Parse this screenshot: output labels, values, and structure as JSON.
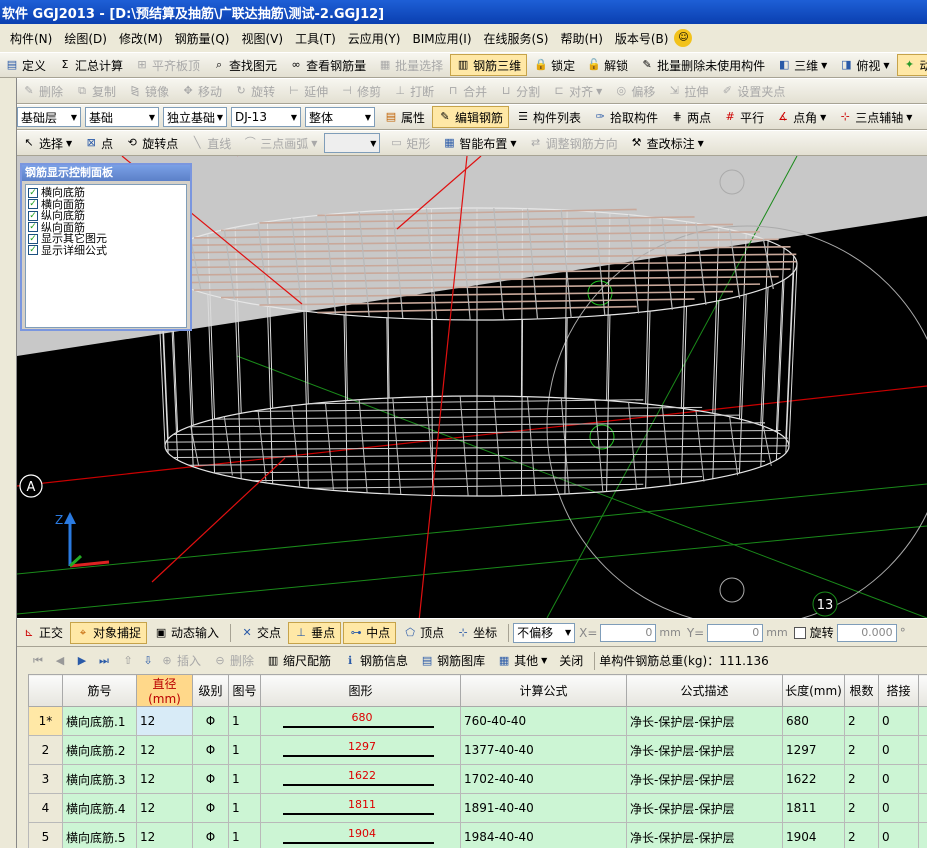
{
  "title": "软件 GGJ2013 - [D:\\预结算及抽筋\\广联达抽筋\\测试-2.GGJ12]",
  "menu": [
    "构件(N)",
    "绘图(D)",
    "修改(M)",
    "钢筋量(Q)",
    "视图(V)",
    "工具(T)",
    "云应用(Y)",
    "BIM应用(I)",
    "在线服务(S)",
    "帮助(H)",
    "版本号(B)"
  ],
  "toolbar1": {
    "define": "定义",
    "sum": "汇总计算",
    "flat": "平齐板顶",
    "find": "查找图元",
    "view_rebar": "查看钢筋量",
    "batch_select": "批量选择",
    "rebar3d": "钢筋三维",
    "lock": "锁定",
    "unlock": "解锁",
    "batch_delete": "批量删除未使用构件",
    "view3d": "三维",
    "topview": "俯视",
    "dynamic": "动"
  },
  "toolbar2": {
    "delete": "删除",
    "copy": "复制",
    "mirror": "镜像",
    "move": "移动",
    "rotate": "旋转",
    "extend": "延伸",
    "trim": "修剪",
    "break": "打断",
    "merge": "合并",
    "split": "分割",
    "align": "对齐",
    "offset": "偏移",
    "stretch": "拉伸",
    "setpoint": "设置夹点"
  },
  "toolbar3": {
    "layer": "基础层",
    "category": "基础",
    "type": "独立基础",
    "component": "DJ-13",
    "whole": "整体",
    "props": "属性",
    "edit_rebar": "编辑钢筋",
    "comp_list": "构件列表",
    "pick": "拾取构件",
    "two_points": "两点",
    "parallel": "平行",
    "point_angle": "点角",
    "three_aux": "三点辅轴"
  },
  "toolbar4": {
    "select": "选择",
    "point": "点",
    "rot_point": "旋转点",
    "line": "直线",
    "arc": "三点画弧",
    "rect": "矩形",
    "smart": "智能布置",
    "adjust": "调整钢筋方向",
    "edit_mark": "查改标注"
  },
  "panel": {
    "title": "钢筋显示控制面板",
    "items": [
      "横向底筋",
      "横向面筋",
      "纵向底筋",
      "纵向面筋",
      "显示其它图元",
      "显示详细公式"
    ]
  },
  "viewport": {
    "axis_a": "A",
    "axis_13": "13",
    "z": "Z"
  },
  "snapbar": {
    "ortho": "正交",
    "osnap": "对象捕捉",
    "dyn_input": "动态输入",
    "intersect": "交点",
    "perp": "垂点",
    "mid": "中点",
    "vertex": "顶点",
    "coord": "坐标",
    "offset_mode": "不偏移",
    "x_label": "X=",
    "x_val": "0",
    "y_label": "Y=",
    "y_val": "0",
    "mm": "mm",
    "rotate": "旋转",
    "rotate_val": "0.000",
    "deg": "°"
  },
  "gridtoolbar": {
    "insert": "插入",
    "delete": "删除",
    "scale": "缩尺配筋",
    "info": "钢筋信息",
    "library": "钢筋图库",
    "other": "其他",
    "close": "关闭",
    "total": "单构件钢筋总重(kg)：111.136"
  },
  "table": {
    "headers": [
      "筋号",
      "直径(mm)",
      "级别",
      "图号",
      "图形",
      "计算公式",
      "公式描述",
      "长度(mm)",
      "根数",
      "搭接"
    ],
    "rows": [
      {
        "no": "1*",
        "name": "横向底筋.1",
        "dia": "12",
        "grade": "Φ",
        "fig": "1",
        "shape": "680",
        "formula": "760-40-40",
        "desc": "净长-保护层-保护层",
        "len": "680",
        "count": "2",
        "lap": "0"
      },
      {
        "no": "2",
        "name": "横向底筋.2",
        "dia": "12",
        "grade": "Φ",
        "fig": "1",
        "shape": "1297",
        "formula": "1377-40-40",
        "desc": "净长-保护层-保护层",
        "len": "1297",
        "count": "2",
        "lap": "0"
      },
      {
        "no": "3",
        "name": "横向底筋.3",
        "dia": "12",
        "grade": "Φ",
        "fig": "1",
        "shape": "1622",
        "formula": "1702-40-40",
        "desc": "净长-保护层-保护层",
        "len": "1622",
        "count": "2",
        "lap": "0"
      },
      {
        "no": "4",
        "name": "横向底筋.4",
        "dia": "12",
        "grade": "Φ",
        "fig": "1",
        "shape": "1811",
        "formula": "1891-40-40",
        "desc": "净长-保护层-保护层",
        "len": "1811",
        "count": "2",
        "lap": "0"
      },
      {
        "no": "5",
        "name": "横向底筋.5",
        "dia": "12",
        "grade": "Φ",
        "fig": "1",
        "shape": "1904",
        "formula": "1984-40-40",
        "desc": "净长-保护层-保护层",
        "len": "1904",
        "count": "2",
        "lap": "0"
      }
    ]
  }
}
